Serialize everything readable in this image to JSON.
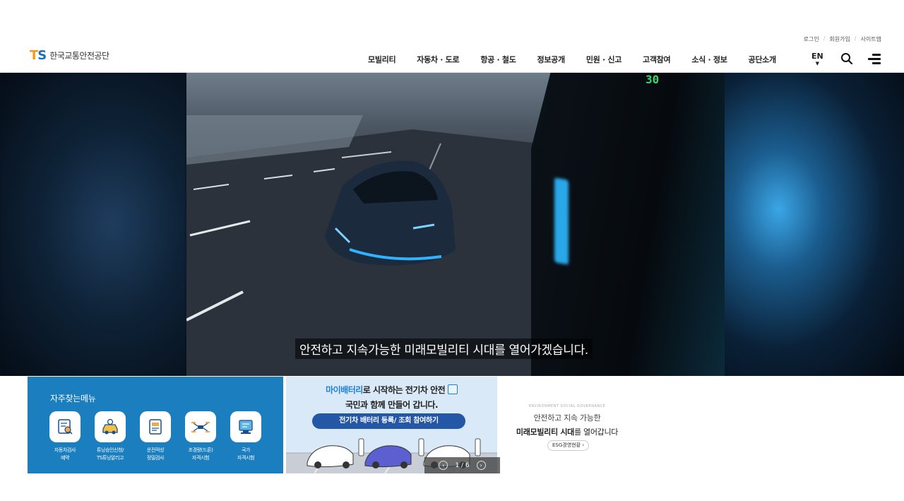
{
  "header": {
    "logo_mark_t": "T",
    "logo_mark_s": "S",
    "logo_text": "한국교통안전공단",
    "util_links": [
      "로그인",
      "회원가입",
      "사이트맵"
    ],
    "nav": [
      "모빌리티",
      "자동차 · 도로",
      "항공 · 철도",
      "정보공개",
      "민원 · 신고",
      "고객참여",
      "소식 · 정보",
      "공단소개"
    ],
    "lang": "EN",
    "icons": {
      "search": "search-icon",
      "menu": "hamburger-menu-icon"
    }
  },
  "hero": {
    "subtitle": "안전하고 지속가능한 미래모빌리티 시대를 열어가겠습니다.",
    "bus_sign": "30"
  },
  "quick_menu": {
    "title": "자주찾는메뉴",
    "items": [
      {
        "label": "자동차검사\n예약",
        "icon": "car-inspection-icon"
      },
      {
        "label": "튜닝승인신청/\nTS튜닝알리고",
        "icon": "car-tuning-icon"
      },
      {
        "label": "운전적성\n정밀검사",
        "icon": "document-icon"
      },
      {
        "label": "초경량(드론)\n자격시험",
        "icon": "drone-icon"
      },
      {
        "label": "국가\n자격시험",
        "icon": "exam-icon"
      }
    ]
  },
  "banner": {
    "line1_highlight": "마이배터리",
    "line1_rest": "로 시작하는 전기차 안전",
    "line2": "국민과 함께 만들어 갑니다.",
    "button": "전기차 배터리 등록/ 조회 참여하기",
    "pager": "1 / 6"
  },
  "esg": {
    "eyebrow": "ENVIRONMENT SOCIAL GOVERNANCE",
    "line1": "안전하고 지속 가능한",
    "line2_bold": "미래모빌리티 시대",
    "line2_rest": "를 열어갑니다",
    "button": "ESG경영현황 ›"
  },
  "colors": {
    "brand_blue": "#1b7fbf",
    "brand_orange": "#f39a1b",
    "banner_bg": "#d9e9f8",
    "banner_button": "#2457a6"
  }
}
